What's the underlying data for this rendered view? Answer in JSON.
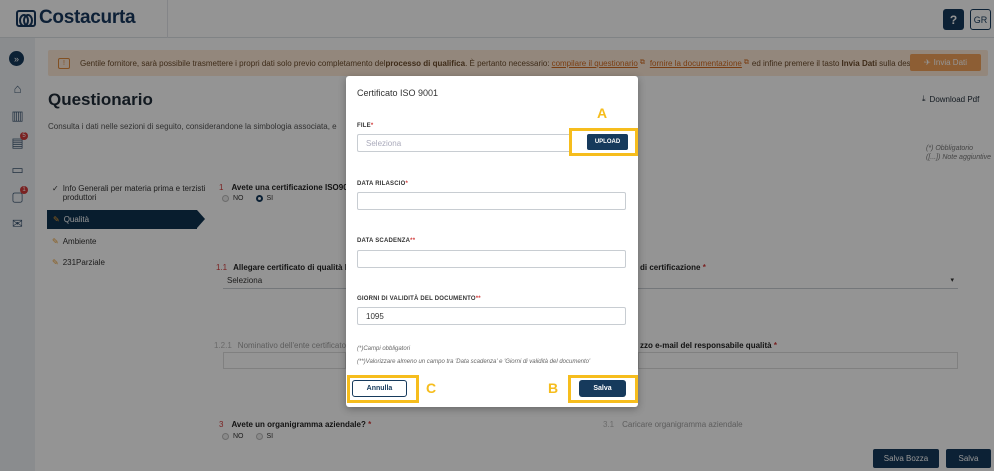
{
  "header": {
    "logo_text": "Costacurta",
    "help_label": "?",
    "user_initials": "GR"
  },
  "rail": {
    "expand_icon": "chevrons-right-icon",
    "badges": [
      "5",
      "1"
    ]
  },
  "notice": {
    "text_prefix": "Gentile fornitore, sarà possibile trasmettere i propri dati solo previo completamento del ",
    "bold": "processo di qualifica",
    "text_mid": ". È pertanto necessario: ",
    "link1": "compilare il questionario",
    "link2": "fornire la documentazione",
    "text_suffix": " ed infine premere il tasto ",
    "bold2": "Invia Dati",
    "text_end": " sulla destra",
    "send_button": "Invia Dati"
  },
  "page": {
    "title": "Questionario",
    "subtitle": "Consulta i dati nelle sezioni di seguito, considerandone la simbologia associata, e",
    "download_label": "Download Pdf",
    "legend_required": "(*) Obbligatorio",
    "legend_notes": "([...]) Note aggiuntive"
  },
  "sections": {
    "item1_line1": "Info Generali per materia prima e terzisti",
    "item1_line2": "produttori",
    "active": "Qualità",
    "item3": "Ambiente",
    "item4": "231Parziale"
  },
  "questions": {
    "q1_num": "1",
    "q1_text": "Avete una certificazione ISO9001 i",
    "no": "NO",
    "si": "SI",
    "q11_num": "1.1",
    "q11_text": "Allegare certificato di qualità ISO",
    "select_value": "Seleziona",
    "cert_label": "di certificazione",
    "q121_num": "1.2.1",
    "q121_text": "Nominativo dell'ente certificatore",
    "email_label": "zzo e-mail del responsabile qualità",
    "q3_num": "3",
    "q3_text": "Avete un organigramma aziendale?",
    "q31_num": "3.1",
    "q31_text": "Caricare organigramma aziendale"
  },
  "footer": {
    "draft_button": "Salva Bozza",
    "save_button": "Salva"
  },
  "modal": {
    "title": "Certificato ISO 9001",
    "file_label": "FILE",
    "file_placeholder": "Seleziona",
    "upload_button": "UPLOAD",
    "release_label": "DATA RILASCIO",
    "expiry_label": "DATA SCADENZA",
    "validity_label": "GIORNI DI VALIDITÀ DEL DOCUMENTO",
    "validity_value": "1095",
    "note1": "(*)Campi obbligatori",
    "note2": "(**)Valorizzare almeno un campo tra 'Data scadenza' e 'Giorni di validità del documento'",
    "cancel_button": "Annulla",
    "save_button": "Salva"
  },
  "callouts": {
    "a": "A",
    "b": "B",
    "c": "C"
  },
  "colors": {
    "primary": "#163a5c",
    "highlight": "#f6bd1d",
    "required": "#d23b3b",
    "notice_bg": "#fde9d6"
  }
}
